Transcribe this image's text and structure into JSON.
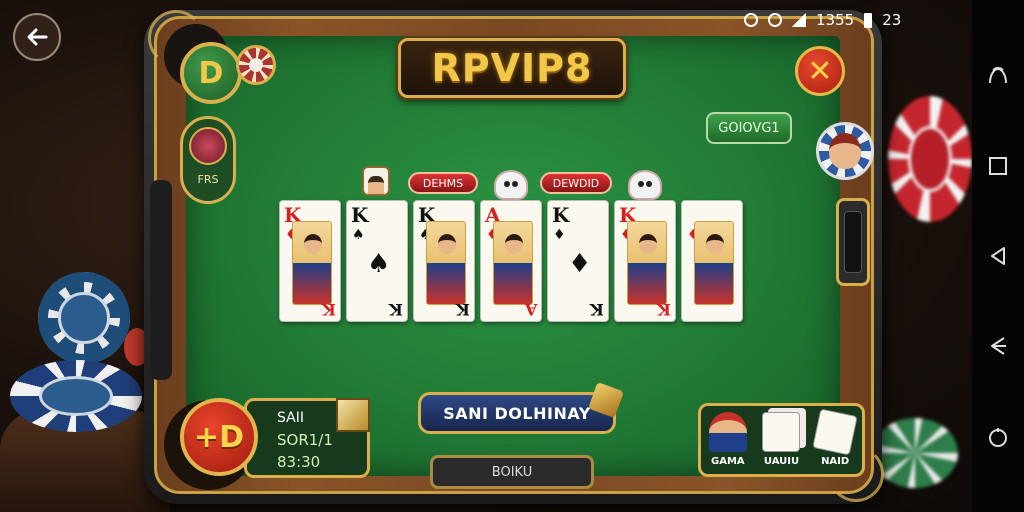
{
  "status_bar": {
    "text": "1355",
    "right": "23"
  },
  "title": "RPVIP8",
  "close_label": "✕",
  "coin_label": "D",
  "left_badge": {
    "label": "FRS"
  },
  "green_tag": "GOIOVG1",
  "player_pills": [
    "DEHMS",
    "DEWDID"
  ],
  "cards": [
    {
      "rank": "K",
      "suit": "♦",
      "color": "red",
      "style": "face"
    },
    {
      "rank": "K",
      "suit": "♠",
      "color": "black",
      "style": "pip"
    },
    {
      "rank": "K",
      "suit": "♠",
      "color": "black",
      "style": "face"
    },
    {
      "rank": "A",
      "suit": "♦",
      "color": "red",
      "style": "face"
    },
    {
      "rank": "K",
      "suit": "♦",
      "color": "black",
      "style": "pip"
    },
    {
      "rank": "K",
      "suit": "♦",
      "color": "red",
      "style": "face"
    },
    {
      "rank": "",
      "suit": "♦",
      "color": "red",
      "style": "face"
    }
  ],
  "hd_button": "+D",
  "info_panel": {
    "line1": "SAII",
    "line2": "SOR1/1",
    "line3": "83:30"
  },
  "main_button": "SANI DOLHINAY",
  "sub_button": "BOIKU",
  "games": [
    {
      "label": "GAMA",
      "icon": "knight-icon"
    },
    {
      "label": "UAUIU",
      "icon": "cards-icon"
    },
    {
      "label": "NAID",
      "icon": "cards-tilted-icon"
    }
  ],
  "colors": {
    "felt": "#217a35",
    "gold": "#d9b04c",
    "accent_red": "#d42020"
  }
}
